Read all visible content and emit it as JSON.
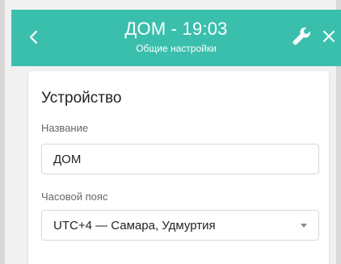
{
  "header": {
    "title": "ДОМ - 19:03",
    "subtitle": "Общие настройки",
    "back_icon": "chevron-left-icon",
    "wrench_icon": "wrench-icon",
    "close_icon": "close-icon",
    "color": "#3bbfad"
  },
  "card": {
    "section_title": "Устройство",
    "name_label": "Название",
    "name_value": "ДОМ",
    "timezone_label": "Часовой пояс",
    "timezone_value": "UTC+4 — Самара, Удмуртия"
  }
}
